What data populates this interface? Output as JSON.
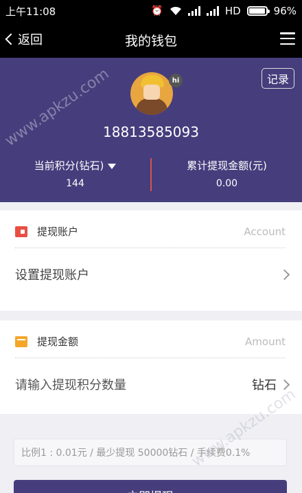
{
  "status": {
    "time": "上午11:08",
    "alarm_icon": "alarm-icon",
    "wifi_icon": "wifi-icon",
    "signal_icon": "signal-icon",
    "network": "HD",
    "battery_level": 0.96,
    "battery_text": "96%"
  },
  "nav": {
    "back_label": "返回",
    "title": "我的钱包",
    "menu_icon": "menu-icon"
  },
  "header": {
    "record_label": "记录",
    "avatar_badge": "hi",
    "phone": "18813585093",
    "stats": {
      "points_label": "当前积分(钻石)",
      "points_value": "144",
      "withdrawn_label": "累计提现金额(元)",
      "withdrawn_value": "0.00"
    },
    "bg_color": "#463d7c"
  },
  "account_card": {
    "title": "提现账户",
    "title_en": "Account",
    "row_label": "设置提现账户",
    "icon_color": "#e84f44"
  },
  "amount_card": {
    "title": "提现金额",
    "title_en": "Amount",
    "placeholder": "请输入提现积分数量",
    "unit": "钻石",
    "icon_color": "#f4a629"
  },
  "note": "比例1 : 0.01元 / 最少提现 50000钻石 / 手续费0.1%",
  "submit_label": "立即提现",
  "watermark": "www.apkzu.com"
}
